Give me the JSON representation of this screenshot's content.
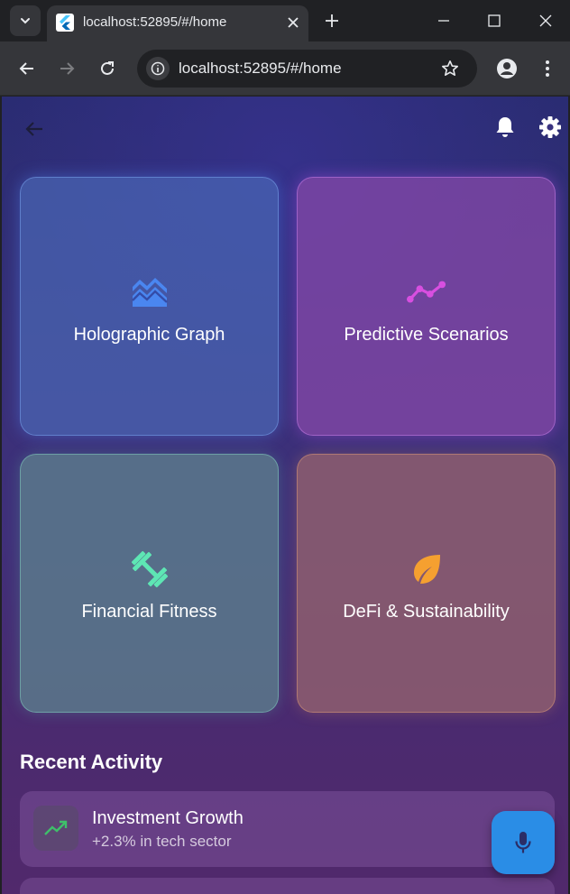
{
  "browser": {
    "tab_title": "localhost:52895/#/home",
    "url": "localhost:52895/#/home"
  },
  "app": {
    "cards": [
      {
        "label": "Holographic Graph",
        "icon": "holographic-graph-icon",
        "color": "#4a86f0"
      },
      {
        "label": "Predictive Scenarios",
        "icon": "trend-line-icon",
        "color": "#d84fe0"
      },
      {
        "label": "Financial Fitness",
        "icon": "dumbbell-icon",
        "color": "#5ee6b4"
      },
      {
        "label": "DeFi & Sustainability",
        "icon": "eco-leaf-icon",
        "color": "#f5a030"
      }
    ],
    "recent_activity": {
      "title": "Recent Activity",
      "items": [
        {
          "title": "Investment Growth",
          "subtitle": "+2.3% in tech sector",
          "icon": "trending-up-icon",
          "icon_color": "#3fbf6a"
        }
      ]
    },
    "fab_icon": "microphone-icon",
    "fab_color": "#2a8de6"
  }
}
